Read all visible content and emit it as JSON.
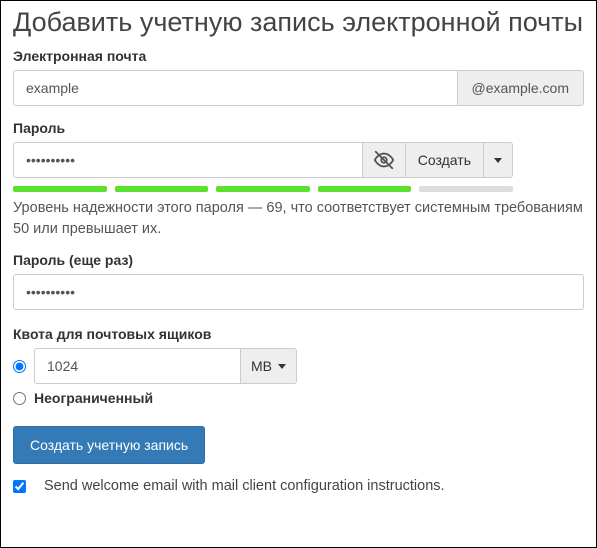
{
  "title": "Добавить учетную запись электронной почты",
  "email": {
    "label": "Электронная почта",
    "value": "example",
    "domain": "@example.com"
  },
  "password": {
    "label": "Пароль",
    "value": "••••••••••",
    "generate": "Создать",
    "strength_segments": 5,
    "strength_filled": 4,
    "hint": "Уровень надежности этого пароля — 69, что соответствует системным требованиям 50 или превышает их."
  },
  "password_confirm": {
    "label": "Пароль (еще раз)",
    "value": "••••••••••"
  },
  "quota": {
    "label": "Квота для почтовых ящиков",
    "value": "1024",
    "unit": "MB",
    "unlimited_label": "Неограниченный"
  },
  "submit": "Создать учетную запись",
  "welcome": {
    "checked": true,
    "label": "Send welcome email with mail client configuration instructions."
  }
}
